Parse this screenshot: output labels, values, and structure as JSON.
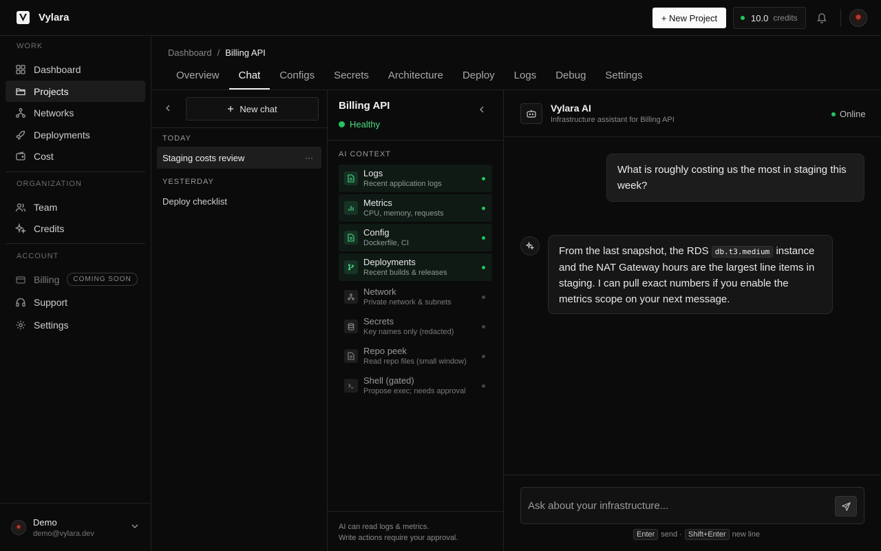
{
  "app": {
    "brand": "Vylara"
  },
  "topbar": {
    "new_project_label": "+ New Project",
    "credits_value": "10.0",
    "credits_label": "credits",
    "accent_color": "#22c55e"
  },
  "sidebar": {
    "sections": {
      "work": "WORK",
      "organization": "ORGANIZATION",
      "account": "ACCOUNT"
    },
    "work_items": [
      {
        "label": "Dashboard",
        "icon": "dashboard-icon"
      },
      {
        "label": "Projects",
        "icon": "folder-icon",
        "active": true
      },
      {
        "label": "Networks",
        "icon": "network-icon"
      },
      {
        "label": "Deployments",
        "icon": "rocket-icon"
      },
      {
        "label": "Cost",
        "icon": "wallet-icon"
      }
    ],
    "org_items": [
      {
        "label": "Team",
        "icon": "team-icon"
      },
      {
        "label": "Credits",
        "icon": "sparkles-icon"
      }
    ],
    "account_items": [
      {
        "label": "Billing",
        "icon": "card-icon",
        "badge": "COMING SOON",
        "disabled": true
      },
      {
        "label": "Support",
        "icon": "headset-icon"
      },
      {
        "label": "Settings",
        "icon": "gear-icon"
      }
    ],
    "user": {
      "name": "Demo",
      "email": "demo@vylara.dev"
    }
  },
  "breadcrumb": {
    "root": "Dashboard",
    "sep": "/",
    "current": "Billing API"
  },
  "tabs": [
    "Overview",
    "Chat",
    "Configs",
    "Secrets",
    "Architecture",
    "Deploy",
    "Logs",
    "Debug",
    "Settings"
  ],
  "active_tab": "Chat",
  "chat_list": {
    "new_chat_label": "New chat",
    "groups": [
      {
        "label": "TODAY",
        "items": [
          "Staging costs review"
        ]
      },
      {
        "label": "YESTERDAY",
        "items": [
          "Deploy checklist"
        ]
      }
    ],
    "more_glyph": "···"
  },
  "context": {
    "project": "Billing API",
    "status": "Healthy",
    "label": "AI CONTEXT",
    "items": [
      {
        "name": "Logs",
        "sub": "Recent application logs",
        "on": true,
        "icon": "file-icon"
      },
      {
        "name": "Metrics",
        "sub": "CPU, memory, requests",
        "on": true,
        "icon": "bar-chart-icon"
      },
      {
        "name": "Config",
        "sub": "Dockerfile, CI",
        "on": true,
        "icon": "file-icon"
      },
      {
        "name": "Deployments",
        "sub": "Recent builds & releases",
        "on": true,
        "icon": "git-branch-icon"
      },
      {
        "name": "Network",
        "sub": "Private network & subnets",
        "on": false,
        "icon": "network-icon"
      },
      {
        "name": "Secrets",
        "sub": "Key names only (redacted)",
        "on": false,
        "icon": "database-icon"
      },
      {
        "name": "Repo peek",
        "sub": "Read repo files (small window)",
        "on": false,
        "icon": "file-icon"
      },
      {
        "name": "Shell (gated)",
        "sub": "Propose exec; needs approval",
        "on": false,
        "icon": "terminal-icon"
      }
    ],
    "footer_line1": "AI can read logs & metrics.",
    "footer_line2": "Write actions require your approval."
  },
  "chat": {
    "assistant_name": "Vylara AI",
    "assistant_sub": "Infrastructure assistant for Billing API",
    "status": "Online",
    "user_message": "What is roughly costing us the most in staging this week?",
    "ai_message_pre": "From the last snapshot, the RDS",
    "ai_message_code": "db.t3.medium",
    "ai_message_post": "instance and the NAT Gateway hours are the largest line items in staging. I can pull exact numbers if you enable the metrics scope on your next message.",
    "input_placeholder": "Ask about your infrastructure...",
    "hint_key1": "Enter",
    "hint_text1": "send ·",
    "hint_key2": "Shift+Enter",
    "hint_text2": "new line"
  }
}
